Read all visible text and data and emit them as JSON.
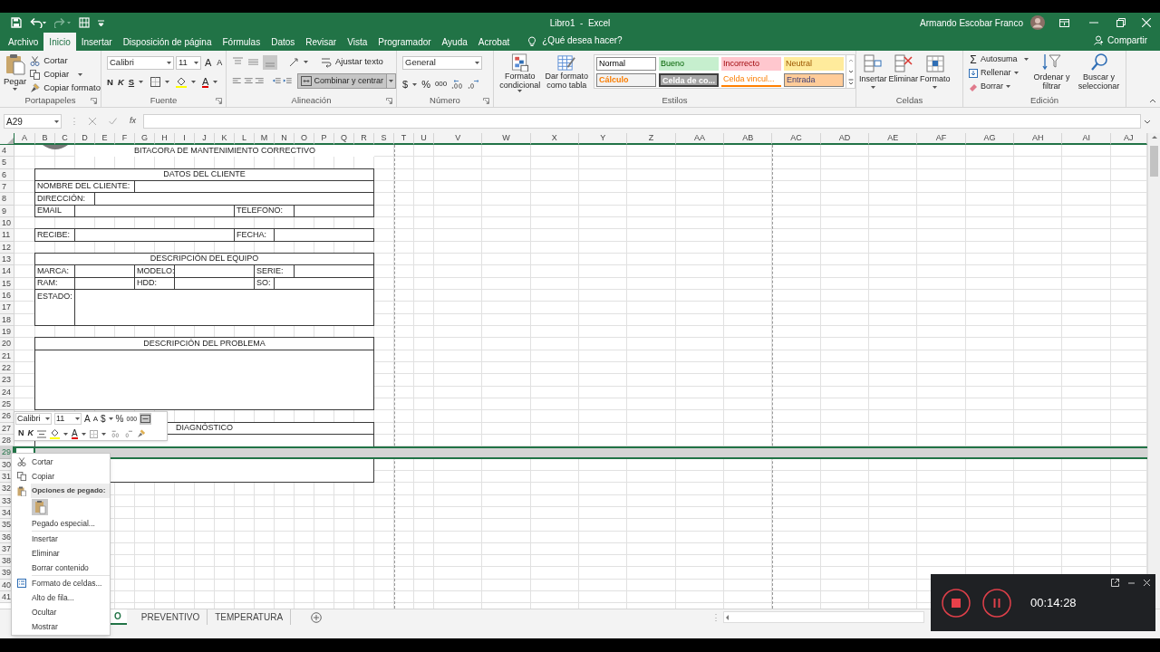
{
  "window": {
    "title": "Libro1  -  Excel",
    "user": "Armando Escobar Franco"
  },
  "tabs": [
    {
      "label": "Archivo",
      "selected": false
    },
    {
      "label": "Inicio",
      "selected": true
    },
    {
      "label": "Insertar",
      "selected": false
    },
    {
      "label": "Disposición de página",
      "selected": false
    },
    {
      "label": "Fórmulas",
      "selected": false
    },
    {
      "label": "Datos",
      "selected": false
    },
    {
      "label": "Revisar",
      "selected": false
    },
    {
      "label": "Vista",
      "selected": false
    },
    {
      "label": "Programador",
      "selected": false
    },
    {
      "label": "Ayuda",
      "selected": false
    },
    {
      "label": "Acrobat",
      "selected": false
    }
  ],
  "tell_me": "¿Qué desea hacer?",
  "share": "Compartir",
  "clipboard": {
    "paste": "Pegar",
    "cut": "Cortar",
    "copy": "Copiar",
    "format_painter": "Copiar formato",
    "group": "Portapapeles"
  },
  "font": {
    "name": "Calibri",
    "size": "11",
    "grow": "A",
    "shrink": "A",
    "bold": "N",
    "italic": "K",
    "underline": "S",
    "font_color_letter": "A",
    "group": "Fuente"
  },
  "alignment": {
    "wrap": "Ajustar texto",
    "merge": "Combinar y centrar",
    "group": "Alineación"
  },
  "number": {
    "format": "General",
    "currency": "$",
    "percent": "%",
    "thousands": "000",
    "group": "Número"
  },
  "styles": {
    "conditional": "Formato condicional",
    "as_table": "Dar formato como tabla",
    "group": "Estilos",
    "gallery": [
      {
        "label": "Normal",
        "kind": "normal"
      },
      {
        "label": "Bueno",
        "kind": "good"
      },
      {
        "label": "Incorrecto",
        "kind": "bad"
      },
      {
        "label": "Neutral",
        "kind": "neutral"
      },
      {
        "label": "Cálculo",
        "kind": "calc"
      },
      {
        "label": "Celda de co...",
        "kind": "check"
      },
      {
        "label": "Celda vincul...",
        "kind": "linked"
      },
      {
        "label": "Entrada",
        "kind": "input"
      }
    ]
  },
  "cells": {
    "insert": "Insertar",
    "delete": "Eliminar",
    "format": "Formato",
    "group": "Celdas"
  },
  "editing": {
    "sum_sign": "Σ",
    "autosum": "Autosuma",
    "fill": "Rellenar",
    "clear": "Borrar",
    "sort": "Ordenar y filtrar",
    "find": "Buscar y seleccionar",
    "group": "Edición"
  },
  "formula_bar": {
    "name_box": "A29",
    "fx": "fx"
  },
  "sheet": {
    "columns": [
      "A",
      "B",
      "C",
      "D",
      "E",
      "F",
      "G",
      "H",
      "I",
      "J",
      "K",
      "L",
      "M",
      "N",
      "O",
      "P",
      "Q",
      "R",
      "S",
      "T",
      "U",
      "V",
      "W",
      "X",
      "Y",
      "Z",
      "AA",
      "AB",
      "AC",
      "AD",
      "AE",
      "AF",
      "AG",
      "AH",
      "AI",
      "AJ"
    ],
    "rows": [
      {
        "label": "4",
        "selected": false
      },
      {
        "label": "5",
        "selected": false
      },
      {
        "label": "6",
        "selected": false
      },
      {
        "label": "7",
        "selected": false
      },
      {
        "label": "8",
        "selected": false
      },
      {
        "label": "9",
        "selected": false
      },
      {
        "label": "10",
        "selected": false
      },
      {
        "label": "11",
        "selected": false
      },
      {
        "label": "12",
        "selected": false
      },
      {
        "label": "13",
        "selected": false
      },
      {
        "label": "14",
        "selected": false
      },
      {
        "label": "15",
        "selected": false
      },
      {
        "label": "16",
        "selected": false
      },
      {
        "label": "17",
        "selected": false
      },
      {
        "label": "18",
        "selected": false
      },
      {
        "label": "19",
        "selected": false
      },
      {
        "label": "20",
        "selected": false
      },
      {
        "label": "21",
        "selected": false
      },
      {
        "label": "22",
        "selected": false
      },
      {
        "label": "23",
        "selected": false
      },
      {
        "label": "24",
        "selected": false
      },
      {
        "label": "25",
        "selected": false
      },
      {
        "label": "26",
        "selected": false
      },
      {
        "label": "27",
        "selected": false
      },
      {
        "label": "28",
        "selected": false
      },
      {
        "label": "29",
        "selected": true
      },
      {
        "label": "30",
        "selected": false
      },
      {
        "label": "31",
        "selected": false
      },
      {
        "label": "32",
        "selected": false
      },
      {
        "label": "33",
        "selected": false
      },
      {
        "label": "34",
        "selected": false
      },
      {
        "label": "35",
        "selected": false
      },
      {
        "label": "36",
        "selected": false
      },
      {
        "label": "37",
        "selected": false
      },
      {
        "label": "38",
        "selected": false
      },
      {
        "label": "39",
        "selected": false
      },
      {
        "label": "40",
        "selected": false
      },
      {
        "label": "41",
        "selected": false
      }
    ],
    "form": [
      "BITACORA DE MANTENIMIENTO CORRECTIVO",
      "DATOS DEL CLIENTE",
      "NOMBRE DEL CLIENTE:",
      "DIRECCIÓN:",
      "EMAIL",
      "TELEFONO:",
      "RECIBE:",
      "FECHA:",
      "DESCRIPCIÓN DEL EQUIPO",
      "MARCA:",
      "MODELO:",
      "SERIE:",
      "RAM:",
      "HDD:",
      "SO:",
      "ESTADO:",
      "DESCRIPCIÓN DEL PROBLEMA",
      "DIAGNÓSTICO"
    ]
  },
  "mini_toolbar": {
    "font": "Calibri",
    "size": "11",
    "grow": "A",
    "shrink": "A",
    "currency": "$",
    "percent": "%",
    "thousands": "000",
    "bold": "N",
    "italic": "K",
    "font_color_letter": "A"
  },
  "context_menu": [
    {
      "label": "Cortar",
      "kind": "item"
    },
    {
      "label": "Copiar",
      "kind": "item"
    },
    {
      "label": "Opciones de pegado:",
      "kind": "header"
    },
    {
      "label": "Pegado especial...",
      "kind": "item"
    },
    {
      "label": "Insertar",
      "kind": "item"
    },
    {
      "label": "Eliminar",
      "kind": "item"
    },
    {
      "label": "Borrar contenido",
      "kind": "item"
    },
    {
      "label": "Formato de celdas...",
      "kind": "item"
    },
    {
      "label": "Alto de fila...",
      "kind": "item"
    },
    {
      "label": "Ocultar",
      "kind": "item"
    },
    {
      "label": "Mostrar",
      "kind": "item"
    }
  ],
  "sheet_tabs": [
    {
      "label": "O",
      "selected": true
    },
    {
      "label": "PREVENTIVO",
      "selected": false
    },
    {
      "label": "TEMPERATURA",
      "selected": false
    }
  ],
  "recorder": {
    "time": "00:14:28"
  }
}
